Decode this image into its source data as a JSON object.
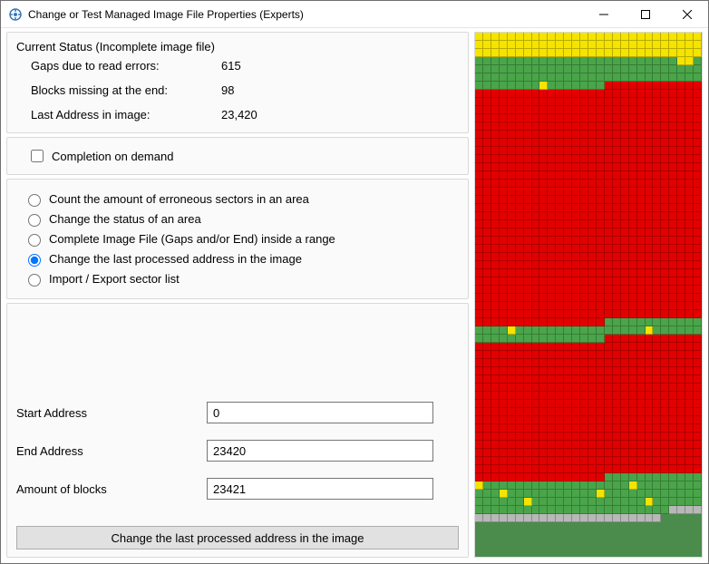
{
  "window": {
    "title": "Change or Test Managed Image File Properties (Experts)"
  },
  "status": {
    "heading": "Current Status (Incomplete image file)",
    "gaps_label": "Gaps due to read errors:",
    "gaps_value": "615",
    "missing_label": "Blocks missing at the end:",
    "missing_value": "98",
    "lastaddr_label": "Last Address in image:",
    "lastaddr_value": "23,420"
  },
  "completion": {
    "label": "Completion on demand",
    "checked": false
  },
  "modes": {
    "opt_count": "Count the amount of erroneous sectors in an area",
    "opt_change_status": "Change the status of an area",
    "opt_complete": "Complete Image File (Gaps and/or End) inside a range",
    "opt_change_last": "Change the last processed address in the image",
    "opt_import_export": "Import / Export sector list",
    "selected": "opt_change_last"
  },
  "form": {
    "start_label": "Start Address",
    "start_value": "0",
    "end_label": "End Address",
    "end_value": "23420",
    "amount_label": "Amount of blocks",
    "amount_value": "23421",
    "button_label": "Change the last processed address in the image"
  },
  "sector_map": {
    "cols": 28,
    "segments": [
      {
        "color": "y",
        "count": 84
      },
      {
        "color": "g",
        "count": 25
      },
      {
        "color": "y",
        "count": 2
      },
      {
        "color": "g",
        "count": 1
      },
      {
        "color": "g",
        "count": 64
      },
      {
        "color": "y",
        "count": 1
      },
      {
        "color": "g",
        "count": 7
      },
      {
        "color": "r",
        "count": 812
      },
      {
        "color": "g",
        "count": 16
      },
      {
        "color": "y",
        "count": 1
      },
      {
        "color": "g",
        "count": 16
      },
      {
        "color": "y",
        "count": 1
      },
      {
        "color": "g",
        "count": 22
      },
      {
        "color": "r",
        "count": 476
      },
      {
        "color": "g",
        "count": 12
      },
      {
        "color": "y",
        "count": 1
      },
      {
        "color": "g",
        "count": 18
      },
      {
        "color": "y",
        "count": 1
      },
      {
        "color": "g",
        "count": 11
      },
      {
        "color": "y",
        "count": 1
      },
      {
        "color": "g",
        "count": 11
      },
      {
        "color": "y",
        "count": 1
      },
      {
        "color": "g",
        "count": 18
      },
      {
        "color": "y",
        "count": 1
      },
      {
        "color": "g",
        "count": 14
      },
      {
        "color": "y",
        "count": 1
      },
      {
        "color": "g",
        "count": 30
      },
      {
        "color": "x",
        "count": 27
      }
    ]
  }
}
